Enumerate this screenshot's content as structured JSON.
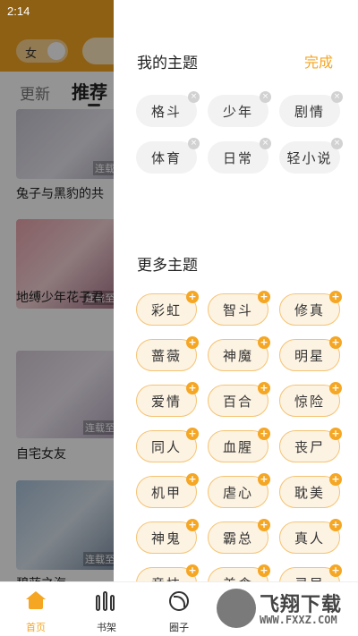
{
  "status_bar": {
    "time": "2:14"
  },
  "background": {
    "gender_label": "女",
    "tabs": [
      "更新",
      "推荐"
    ],
    "cards": [
      {
        "title": "兔子与黑豹的共",
        "badge": "连载"
      },
      {
        "title": "地缚少年花子君",
        "badge": "连载至"
      },
      {
        "title": "自宅女友",
        "badge": "连载至"
      },
      {
        "title": "碧蓝之海",
        "badge": "连载至"
      }
    ]
  },
  "drawer": {
    "my_title": "我的主题",
    "done_label": "完成",
    "my_topics": [
      "格斗",
      "少年",
      "剧情",
      "体育",
      "日常",
      "轻小说"
    ],
    "more_title": "更多主题",
    "more_topics": [
      "彩虹",
      "智斗",
      "修真",
      "蔷薇",
      "神魔",
      "明星",
      "爱情",
      "百合",
      "惊险",
      "同人",
      "血腥",
      "丧尸",
      "机甲",
      "虐心",
      "耽美",
      "神鬼",
      "霸总",
      "真人",
      "竞技",
      "美食",
      "灵异"
    ],
    "remove_glyph": "×",
    "add_glyph": "+"
  },
  "bottom_nav": {
    "items": [
      {
        "label": "首页",
        "active": true
      },
      {
        "label": "书架",
        "active": false
      },
      {
        "label": "圈子",
        "active": false
      }
    ]
  },
  "watermark": {
    "text": "飞翔下载",
    "url": "WWW.FXXZ.COM"
  },
  "colors": {
    "accent": "#f5a623",
    "chip_mine_bg": "#f2f2f2",
    "chip_more_bg": "#fdf3e3",
    "chip_more_border": "#f5c373"
  }
}
